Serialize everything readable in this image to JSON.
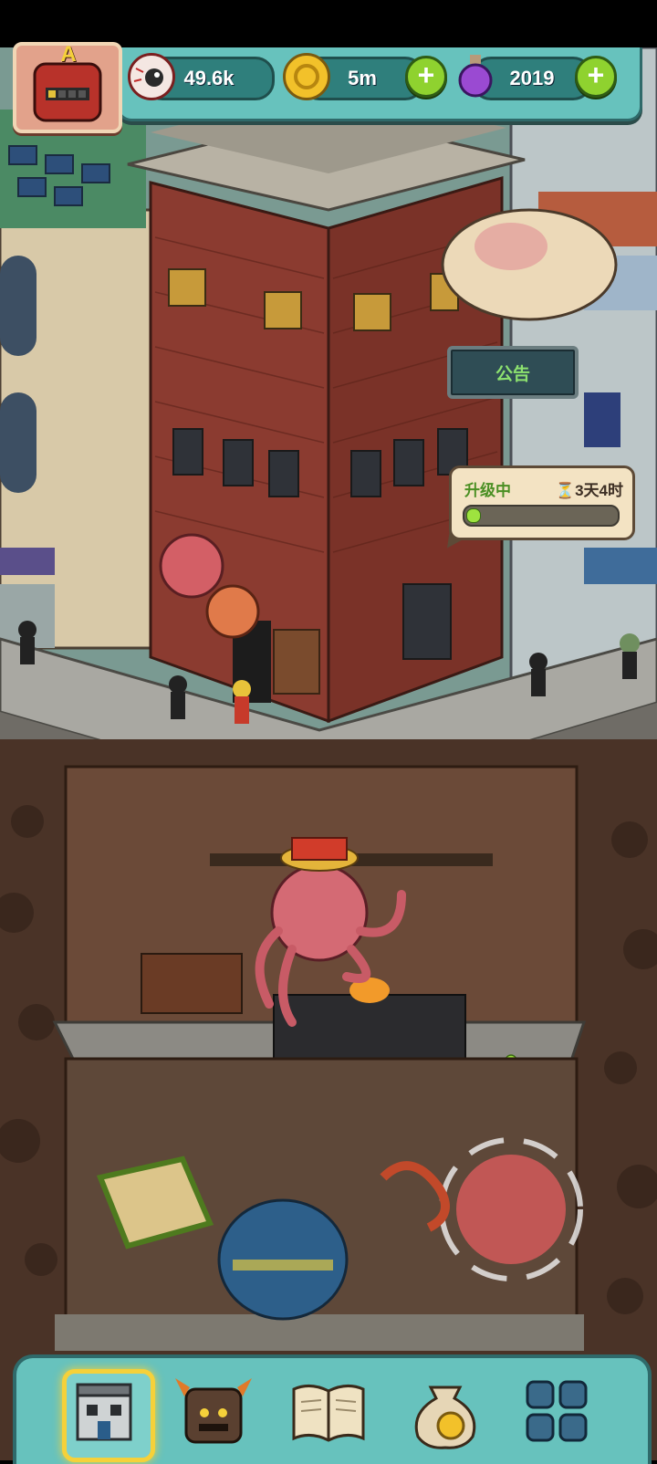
{
  "hud": {
    "eye_value": "49.6k",
    "coin_value": "5m",
    "potion_value": "2019",
    "rank_letter": "A",
    "plus_symbol": "+"
  },
  "building": {
    "notice_label": "公告"
  },
  "upgrade": {
    "status_label": "升级中",
    "hourglass": "⏳",
    "time_remaining": "3天4时",
    "progress": 0.04
  },
  "colors": {
    "hud_bg": "#67c2bd",
    "accent_green": "#8fd22f",
    "brick": "#8b3b30",
    "dirt": "#5a3e2e"
  },
  "nav": {
    "items": [
      {
        "name": "nav-building",
        "icon": "building-icon",
        "active": true
      },
      {
        "name": "nav-monster",
        "icon": "monster-icon",
        "active": false
      },
      {
        "name": "nav-book",
        "icon": "book-icon",
        "active": false
      },
      {
        "name": "nav-coin-bag",
        "icon": "coin-bag-icon",
        "active": false
      },
      {
        "name": "nav-menu-grid",
        "icon": "grid-icon",
        "active": false
      }
    ]
  }
}
